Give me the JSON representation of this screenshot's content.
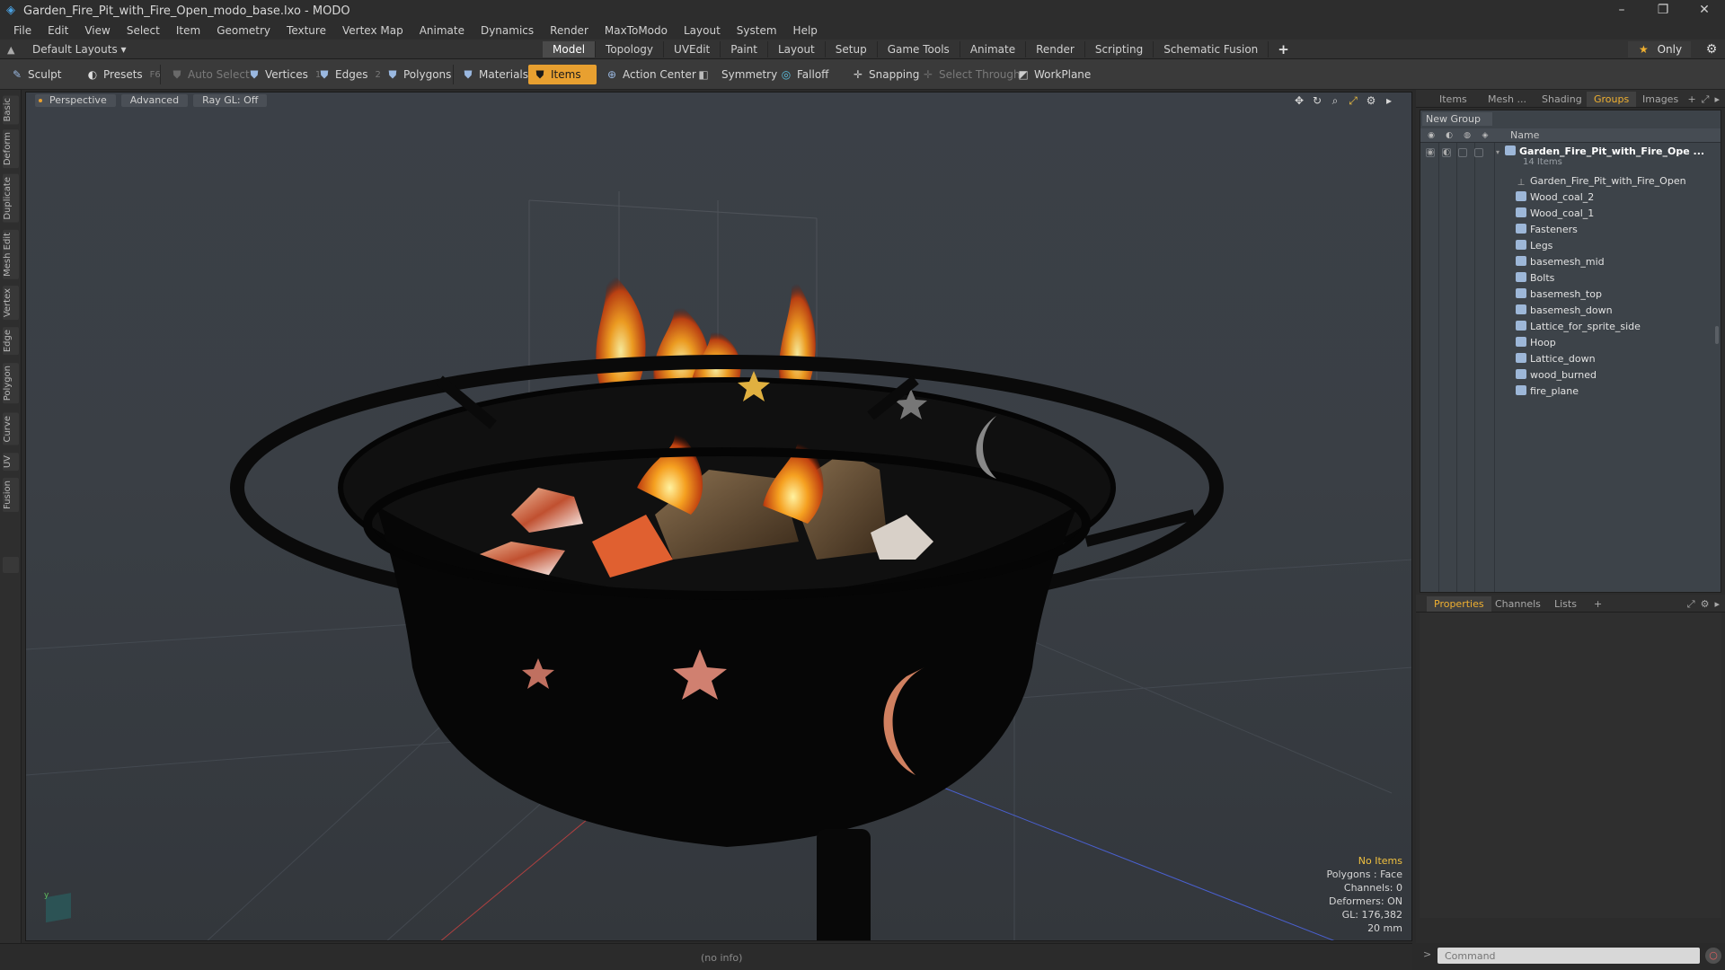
{
  "window": {
    "title": "Garden_Fire_Pit_with_Fire_Open_modo_base.lxo - MODO",
    "controls": [
      "–",
      "❐",
      "✕"
    ]
  },
  "menu": [
    "File",
    "Edit",
    "View",
    "Select",
    "Item",
    "Geometry",
    "Texture",
    "Vertex Map",
    "Animate",
    "Dynamics",
    "Render",
    "MaxToModo",
    "Layout",
    "System",
    "Help"
  ],
  "layout_bar": {
    "layout_selector": "Default Layouts ▾",
    "tabs": [
      "Model",
      "Topology",
      "UVEdit",
      "Paint",
      "Layout",
      "Setup",
      "Game Tools",
      "Animate",
      "Render",
      "Scripting",
      "Schematic Fusion"
    ],
    "active_tab": "Model",
    "add_tab": "+",
    "only_label": "Only"
  },
  "toolbar": {
    "sculpt": "Sculpt",
    "presets": "Presets",
    "presets_key": "F6",
    "auto_select": "Auto Select",
    "vertices": "Vertices",
    "vertices_key": "1",
    "edges": "Edges",
    "edges_key": "2",
    "polygons": "Polygons",
    "materials": "Materials",
    "items": "Items",
    "action_center": "Action Center",
    "symmetry": "Symmetry",
    "falloff": "Falloff",
    "snapping": "Snapping",
    "select_through": "Select Through",
    "workplane": "WorkPlane"
  },
  "left_tabs": [
    "Basic",
    "Deform",
    "Duplicate",
    "Mesh Edit",
    "Vertex",
    "Edge",
    "Polygon",
    "Curve",
    "UV",
    "Fusion"
  ],
  "viewport": {
    "view_mode": "Perspective",
    "advanced": "Advanced",
    "raygl": "Ray GL: Off",
    "info": {
      "selection": "No Items",
      "polygons": "Polygons : Face",
      "channels": "Channels: 0",
      "deformers": "Deformers: ON",
      "gl": "GL: 176,382",
      "scale": "20 mm"
    }
  },
  "top_panel": {
    "tabs": [
      "Items",
      "Mesh ...",
      "Shading",
      "Groups",
      "Images"
    ],
    "active_tab": "Groups",
    "new_group": "New Group",
    "name_column": "Name",
    "group": {
      "name": "Garden_Fire_Pit_with_Fire_Ope ...",
      "count": "14 Items"
    },
    "items": [
      "Garden_Fire_Pit_with_Fire_Open",
      "Wood_coal_2",
      "Wood_coal_1",
      "Fasteners",
      "Legs",
      "basemesh_mid",
      "Bolts",
      "basemesh_top",
      "basemesh_down",
      "Lattice_for_sprite_side",
      "Hoop",
      "Lattice_down",
      "wood_burned",
      "fire_plane"
    ]
  },
  "bottom_panel": {
    "tabs": [
      "Properties",
      "Channels",
      "Lists"
    ],
    "active_tab": "Properties",
    "add": "+"
  },
  "command": {
    "placeholder": "Command"
  },
  "status": {
    "info": "(no info)"
  },
  "colors": {
    "accent": "#e8a030",
    "active_tab_text": "#f0b030",
    "viewport_bg": "#3a3f45"
  }
}
